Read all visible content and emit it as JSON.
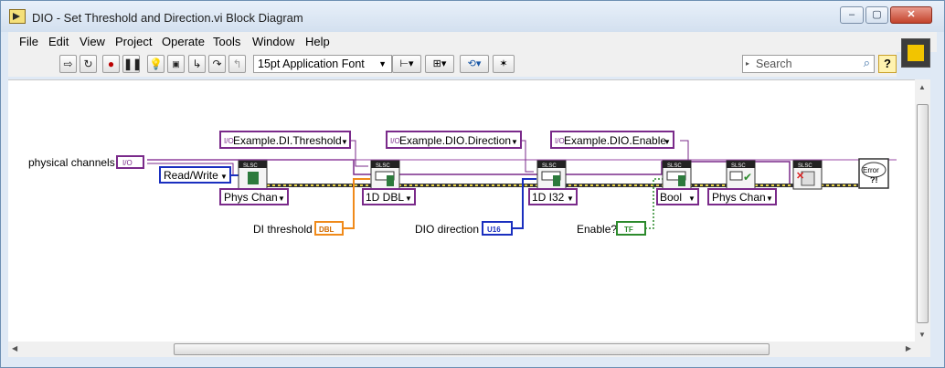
{
  "window": {
    "title": "DIO - Set Threshold and Direction.vi Block Diagram"
  },
  "menu": [
    "File",
    "Edit",
    "View",
    "Project",
    "Operate",
    "Tools",
    "Window",
    "Help"
  ],
  "toolbar": {
    "font": "15pt Application Font",
    "search_placeholder": "Search",
    "help": "?"
  },
  "diagram": {
    "physical_channels_label": "physical channels",
    "io_terminal": "I/O",
    "read_write": "Read/Write",
    "prop_threshold": "Example.DI.Threshold",
    "prop_direction": "Example.DIO.Direction",
    "prop_enable": "Example.DIO.Enable",
    "phys_chan_1": "Phys Chan",
    "type_1d_dbl": "1D DBL",
    "type_1d_i32": "1D I32",
    "type_bool": "Bool",
    "phys_chan_2": "Phys Chan",
    "di_threshold_label": "DI threshold",
    "dbl_terminal": "DBL",
    "dio_direction_label": "DIO direction",
    "u16_terminal": "U16",
    "enable_label": "Enable?",
    "tf_terminal": "TF",
    "error_label": "Error",
    "slsc": "SLSC"
  }
}
